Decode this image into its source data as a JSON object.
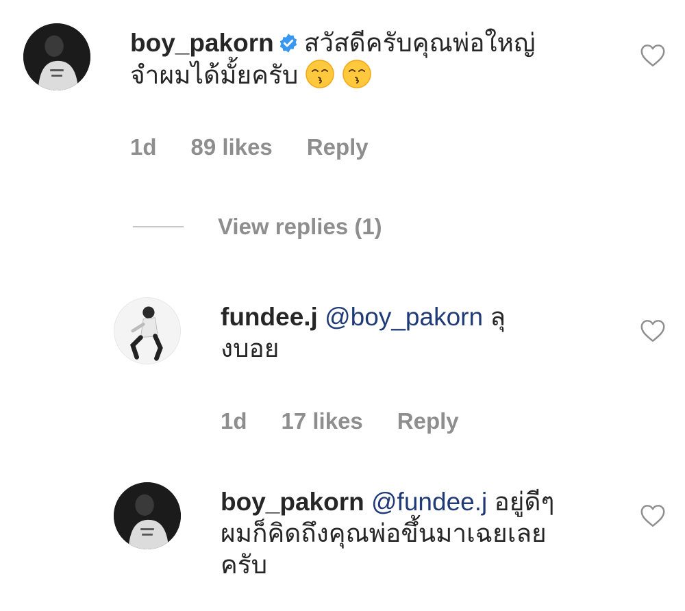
{
  "comment": {
    "username": "boy_pakorn",
    "verified": true,
    "text_line1": "สวัสดีครับคุณพ่อใหญ่",
    "text_line2": "จำผมได้มั้ยครับ",
    "emojis": [
      "kissing-face-emoji",
      "kissing-face-emoji"
    ],
    "meta": {
      "time": "1d",
      "likes": "89 likes",
      "reply": "Reply"
    }
  },
  "view_replies": {
    "label": "View replies (1)"
  },
  "replies": [
    {
      "username": "fundee.j",
      "mention": "@boy_pakorn",
      "text_line1": "ลุ",
      "text_line2": "งบอย",
      "meta": {
        "time": "1d",
        "likes": "17 likes",
        "reply": "Reply"
      }
    },
    {
      "username": "boy_pakorn",
      "mention": "@fundee.j",
      "text_line1": "อยู่ดีๆ",
      "text_line2": "ผมก็คิดถึงคุณพ่อขึ้นมาเฉยเลย",
      "text_line3": "ครับ"
    }
  ],
  "icons": {
    "like": "heart-outline-icon",
    "verified": "verified-badge-icon"
  },
  "colors": {
    "verified_blue": "#3897f0",
    "mention_blue": "#1f3a76",
    "meta_gray": "#8e8e8e"
  }
}
